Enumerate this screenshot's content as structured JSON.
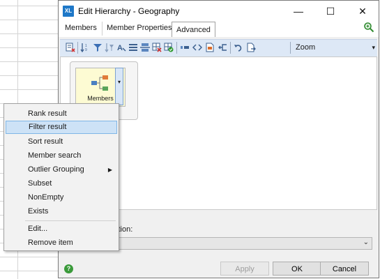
{
  "window": {
    "title": "Edit Hierarchy - Geography",
    "logo_text": "XL"
  },
  "window_controls": {
    "minimize": "—",
    "maximize": "☐",
    "close": "✕"
  },
  "tabs": [
    {
      "label": "Members",
      "active": false
    },
    {
      "label": "Member Properties",
      "active": false
    },
    {
      "label": "Advanced",
      "active": true
    }
  ],
  "toolbar": {
    "zoom_label": "Zoom",
    "overflow": "▾",
    "icons": [
      "remove-filter-icon",
      "sort-icon",
      "filter-icon",
      "filter-advanced-icon",
      "text-format-icon",
      "list-icon",
      "split-icon",
      "grid-remove-icon",
      "grid-check-icon",
      "dash-icon",
      "code-icon",
      "document-icon",
      "merge-icon",
      "undo-icon",
      "export-icon"
    ]
  },
  "canvas": {
    "member_card_label": "Members",
    "dropdown_glyph": "▾"
  },
  "bottom": {
    "action_label": "ction:",
    "action_value": "",
    "chevron": "⌄"
  },
  "footer": {
    "help": "?",
    "apply": "Apply",
    "ok": "OK",
    "cancel": "Cancel"
  },
  "context_menu": {
    "items": [
      {
        "label": "Rank result"
      },
      {
        "label": "Filter result",
        "selected": true
      },
      {
        "label": "Sort result"
      },
      {
        "label": "Member search"
      },
      {
        "label": "Outlier Grouping",
        "submenu": true,
        "arrow": "▶"
      },
      {
        "label": "Subset"
      },
      {
        "label": "NonEmpty"
      },
      {
        "label": "Exists"
      },
      {
        "label": "Edit..."
      },
      {
        "label": "Remove item"
      }
    ]
  },
  "colors": {
    "toolbar_bg": "#dde8f6",
    "menu_highlight": "#cde2f6",
    "member_card_fill": "#fdfbd3",
    "help_green": "#3a9a3a"
  }
}
